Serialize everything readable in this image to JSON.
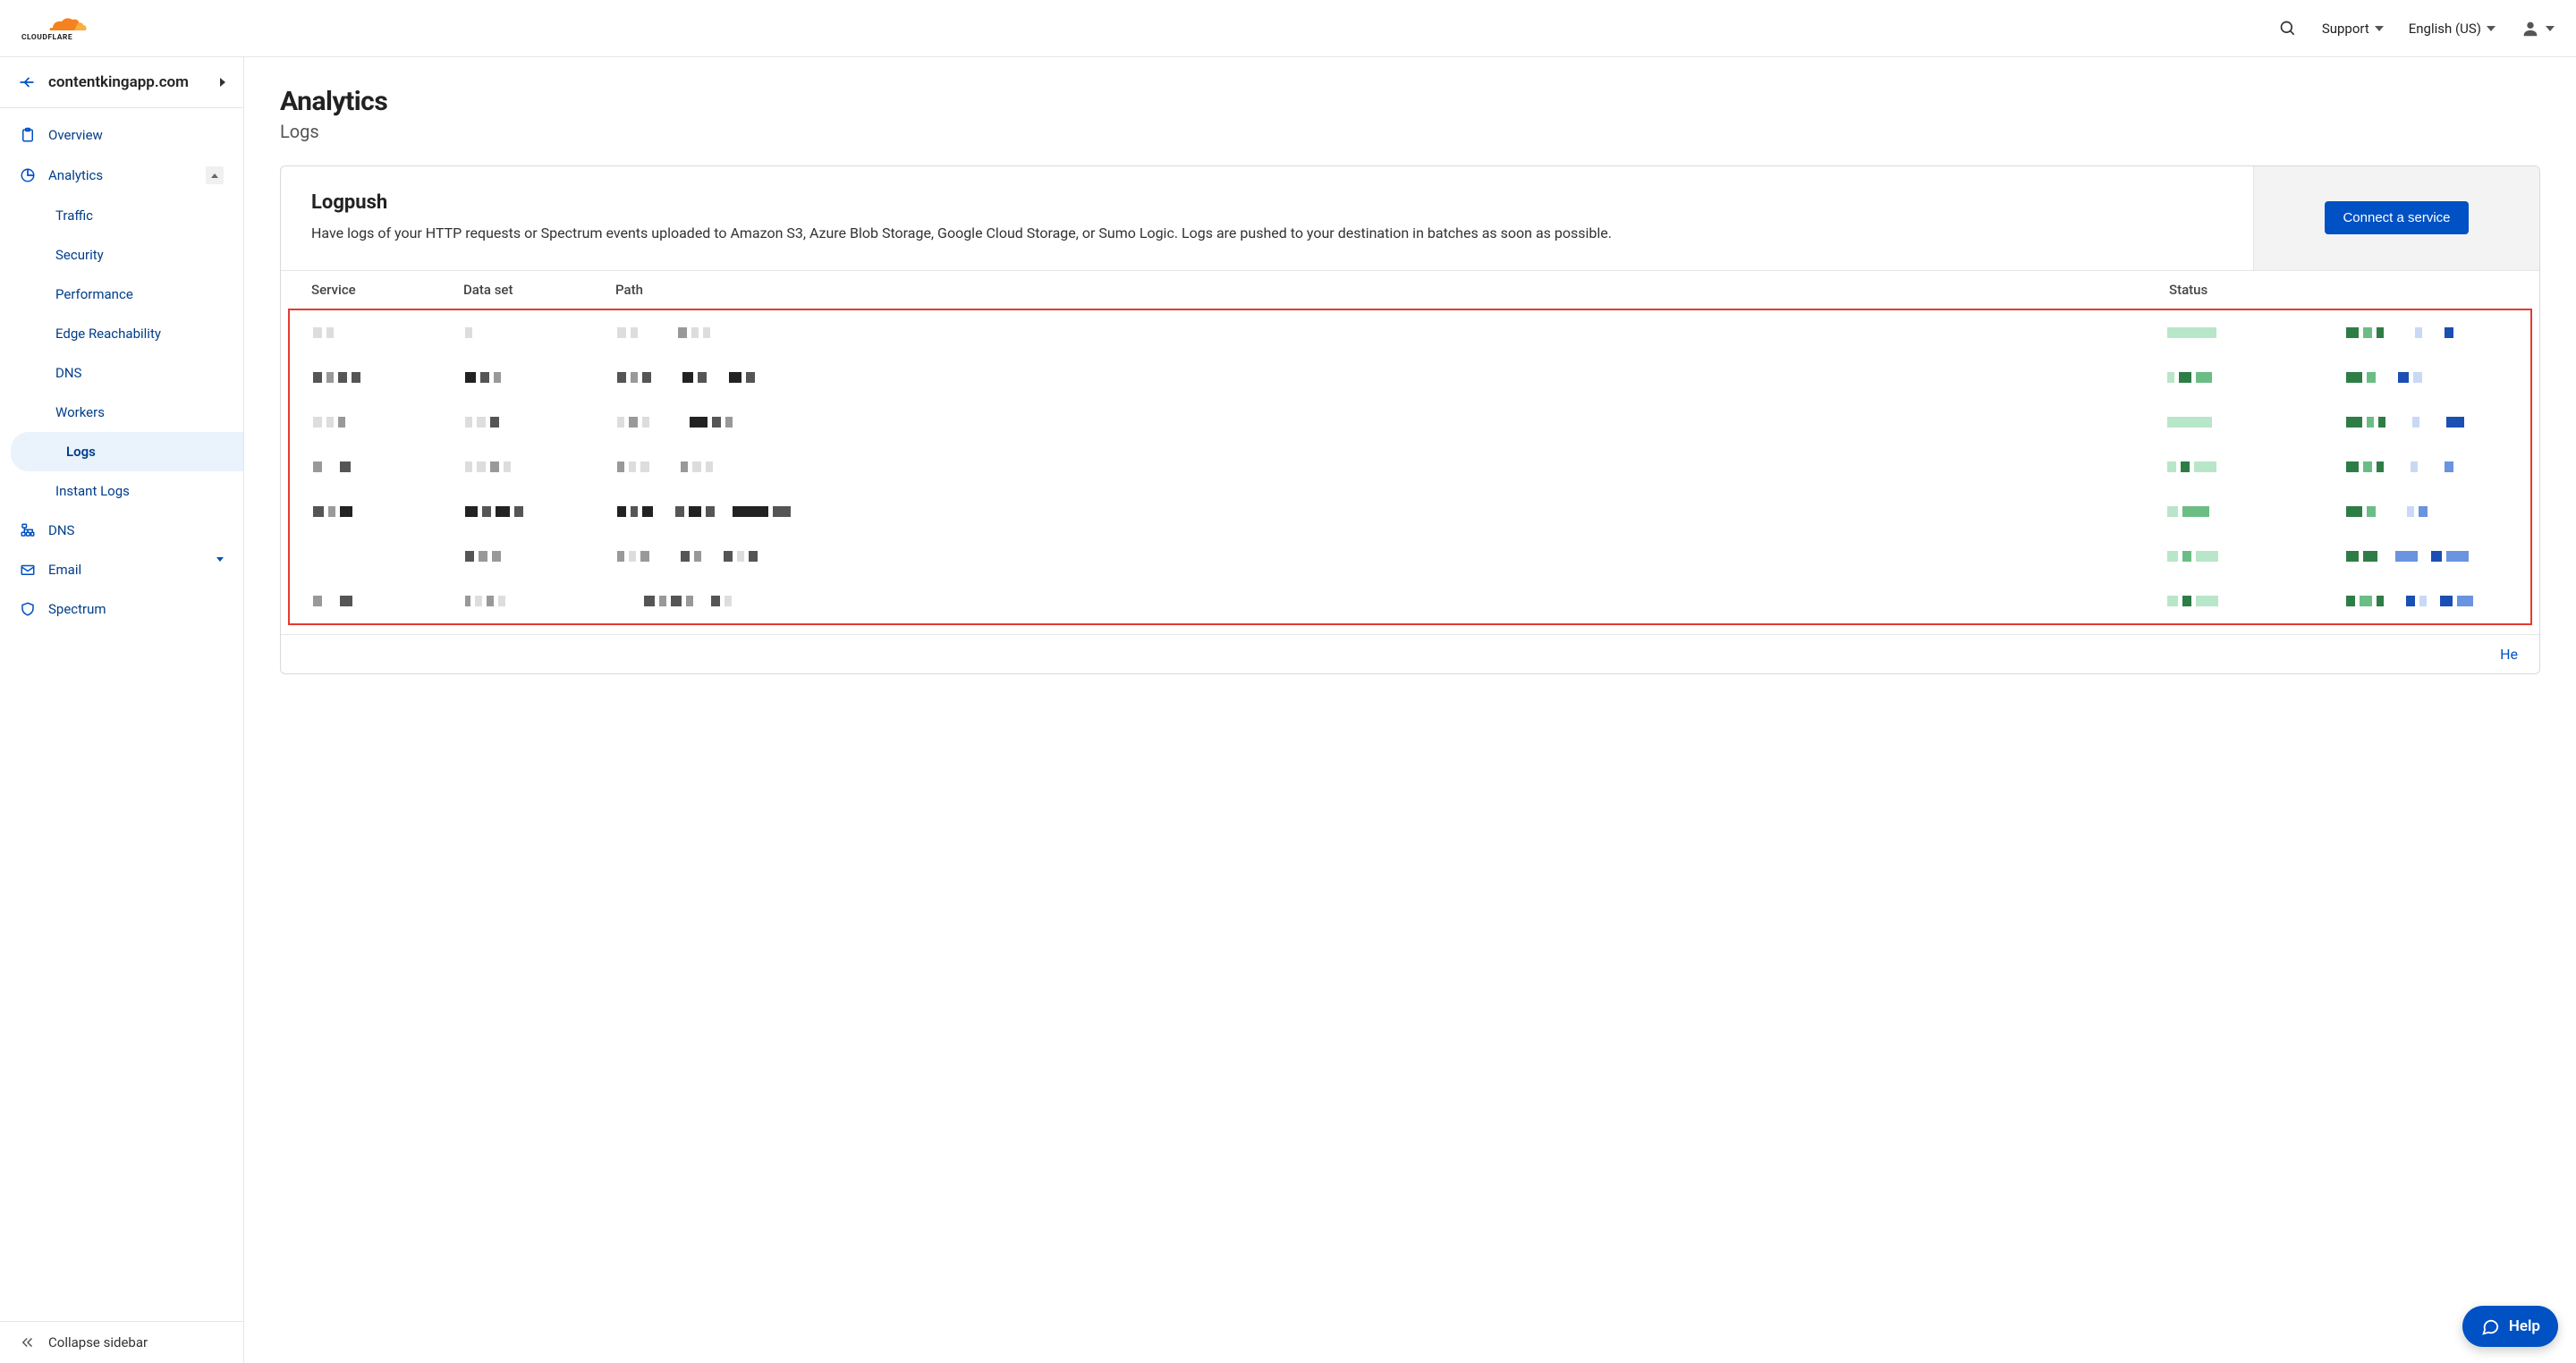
{
  "brand": "CLOUDFLARE",
  "header": {
    "support": "Support",
    "language": "English (US)"
  },
  "domain": "contentkingapp.com",
  "nav": {
    "overview": "Overview",
    "analytics": "Analytics",
    "analytics_children": {
      "traffic": "Traffic",
      "security": "Security",
      "performance": "Performance",
      "edge": "Edge Reachability",
      "dns": "DNS",
      "workers": "Workers",
      "logs": "Logs",
      "instant_logs": "Instant Logs"
    },
    "dns": "DNS",
    "email": "Email",
    "spectrum": "Spectrum",
    "collapse": "Collapse sidebar"
  },
  "page": {
    "title": "Analytics",
    "subtitle": "Logs"
  },
  "logpush": {
    "title": "Logpush",
    "desc": "Have logs of your HTTP requests or Spectrum events uploaded to Amazon S3, Azure Blob Storage, Google Cloud Storage, or Sumo Logic. Logs are pushed to your destination in batches as soon as possible.",
    "connect": "Connect a service"
  },
  "table": {
    "cols": {
      "service": "Service",
      "dataset": "Data set",
      "path": "Path",
      "status": "Status"
    },
    "help": "He"
  },
  "help_widget": "Help"
}
